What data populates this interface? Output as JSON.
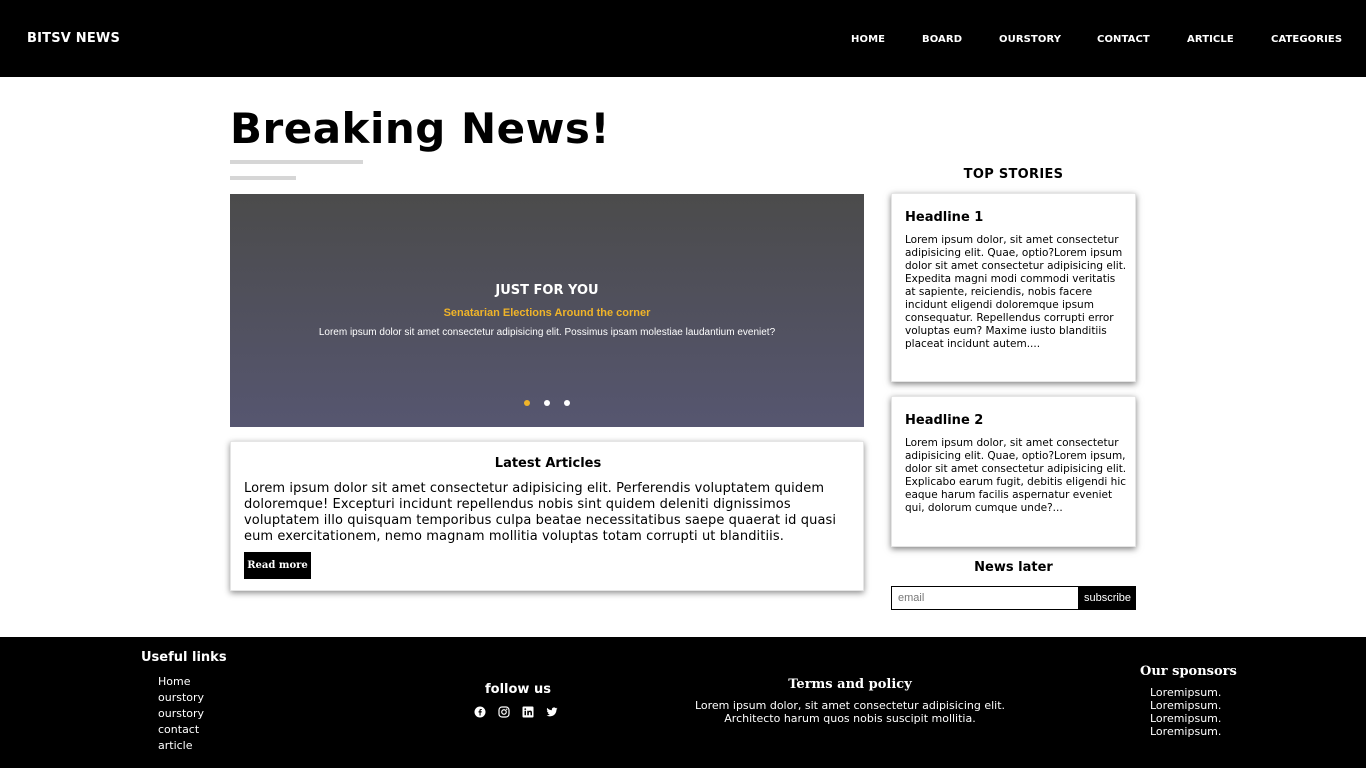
{
  "navbar": {
    "brand": "BITSV NEWS",
    "links": [
      "HOME",
      "BOARD",
      "OURSTORY",
      "CONTACT",
      "ARTICLE",
      "CATEGORIES"
    ]
  },
  "main": {
    "title": "Breaking News!",
    "carousel": {
      "heading": "JUST FOR YOU",
      "subheading": "Senatarian Elections Around the corner",
      "text": "Lorem ipsum dolor sit amet consectetur adipisicing elit. Possimus ipsam molestiae laudantium eveniet?",
      "active_slide": 1,
      "slide_count": 3
    },
    "latest": {
      "title": "Latest Articles",
      "body": "Lorem ipsum dolor sit amet consectetur adipisicing elit. Perferendis voluptatem quidem doloremque! Excepturi incidunt repellendus nobis sint quidem deleniti dignissimos voluptatem illo quisquam temporibus culpa beatae necessitatibus saepe quaerat id quasi eum exercitationem, nemo magnam mollitia voluptas totam corrupti ut blanditiis.",
      "button": "Read more"
    }
  },
  "sidebar": {
    "title": "TOP STORIES",
    "stories": [
      {
        "headline": "Headline 1",
        "text": "Lorem ipsum dolor, sit amet consectetur adipisicing elit. Quae, optio?Lorem ipsum dolor sit amet consectetur adipisicing elit. Expedita magni modi commodi veritatis at sapiente, reiciendis, nobis facere incidunt eligendi doloremque ipsum consequatur. Repellendus corrupti error voluptas eum? Maxime iusto blanditiis placeat incidunt autem...."
      },
      {
        "headline": "Headline 2",
        "text": "Lorem ipsum dolor, sit amet consectetur adipisicing elit. Quae, optio?Lorem ipsum, dolor sit amet consectetur adipisicing elit. Explicabo earum fugit, debitis eligendi hic eaque harum facilis aspernatur eveniet qui, dolorum cumque unde?..."
      }
    ],
    "newsletter": {
      "title": "News later",
      "placeholder": "email",
      "value": "",
      "button": "subscribe"
    }
  },
  "footer": {
    "useful_title": "Useful links",
    "useful_links": [
      "Home",
      "ourstory",
      "ourstory",
      "contact",
      "article"
    ],
    "follow_title": "follow us",
    "social_icons": [
      "facebook-icon",
      "instagram-icon",
      "linkedin-icon",
      "twitter-icon"
    ],
    "terms_title": "Terms and policy",
    "terms_text": "Lorem ipsum dolor, sit amet consectetur adipisicing elit. Architecto harum quos nobis suscipit mollitia.",
    "sponsors_title": "Our sponsors",
    "sponsors": [
      "Loremipsum.",
      "Loremipsum.",
      "Loremipsum.",
      "Loremipsum."
    ]
  },
  "colors": {
    "background": "#ffffff",
    "navbar": "#000000",
    "accent": "#f0b429",
    "carousel_top": "#4b4b4b",
    "carousel_bottom": "#565670"
  }
}
